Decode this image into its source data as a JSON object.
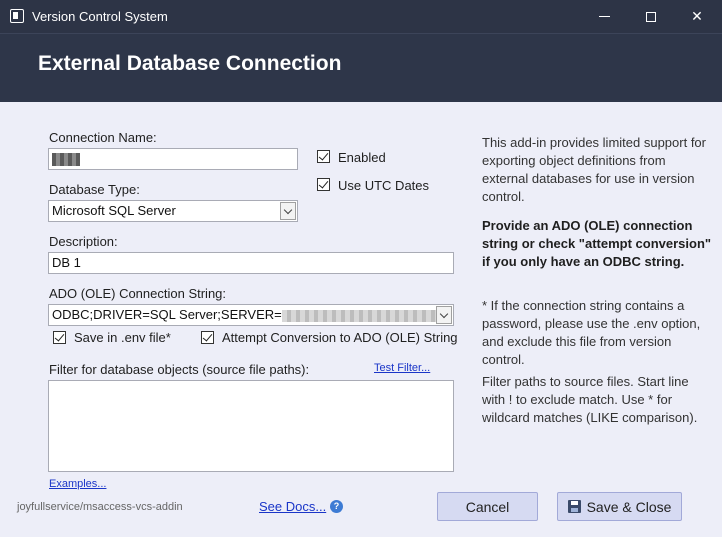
{
  "window": {
    "title": "Version Control System"
  },
  "header": {
    "title": "External Database Connection"
  },
  "form": {
    "connection_name_label": "Connection Name:",
    "database_type_label": "Database Type:",
    "database_type_value": "Microsoft SQL Server",
    "description_label": "Description:",
    "description_value": "DB 1",
    "connection_string_label": "ADO (OLE) Connection String:",
    "connection_string_value": "ODBC;DRIVER=SQL Server;SERVER=",
    "enabled_label": "Enabled",
    "enabled_checked": true,
    "utc_label": "Use UTC Dates",
    "utc_checked": true,
    "env_label": "Save in .env file*",
    "env_checked": true,
    "attempt_label": "Attempt Conversion to ADO (OLE) String",
    "attempt_checked": true,
    "filter_label": "Filter for database objects (source file paths):",
    "test_filter_link": "Test Filter...",
    "examples_link": "Examples..."
  },
  "info": {
    "p1": "This add-in provides limited support for exporting object definitions from external databases for use in version control.",
    "p2": "Provide an ADO (OLE) connection string or check \"attempt conversion\" if you only have an ODBC string.",
    "p3": "* If the connection string contains a password, please use the .env option, and exclude this file from version control.",
    "p4": "Filter paths to source files. Start line with ! to exclude match. Use * for wildcard matches (LIKE comparison)."
  },
  "footer": {
    "repo": "joyfullservice/msaccess-vcs-addin",
    "docs_link": "See Docs...",
    "cancel_label": "Cancel",
    "save_label": "Save & Close"
  }
}
